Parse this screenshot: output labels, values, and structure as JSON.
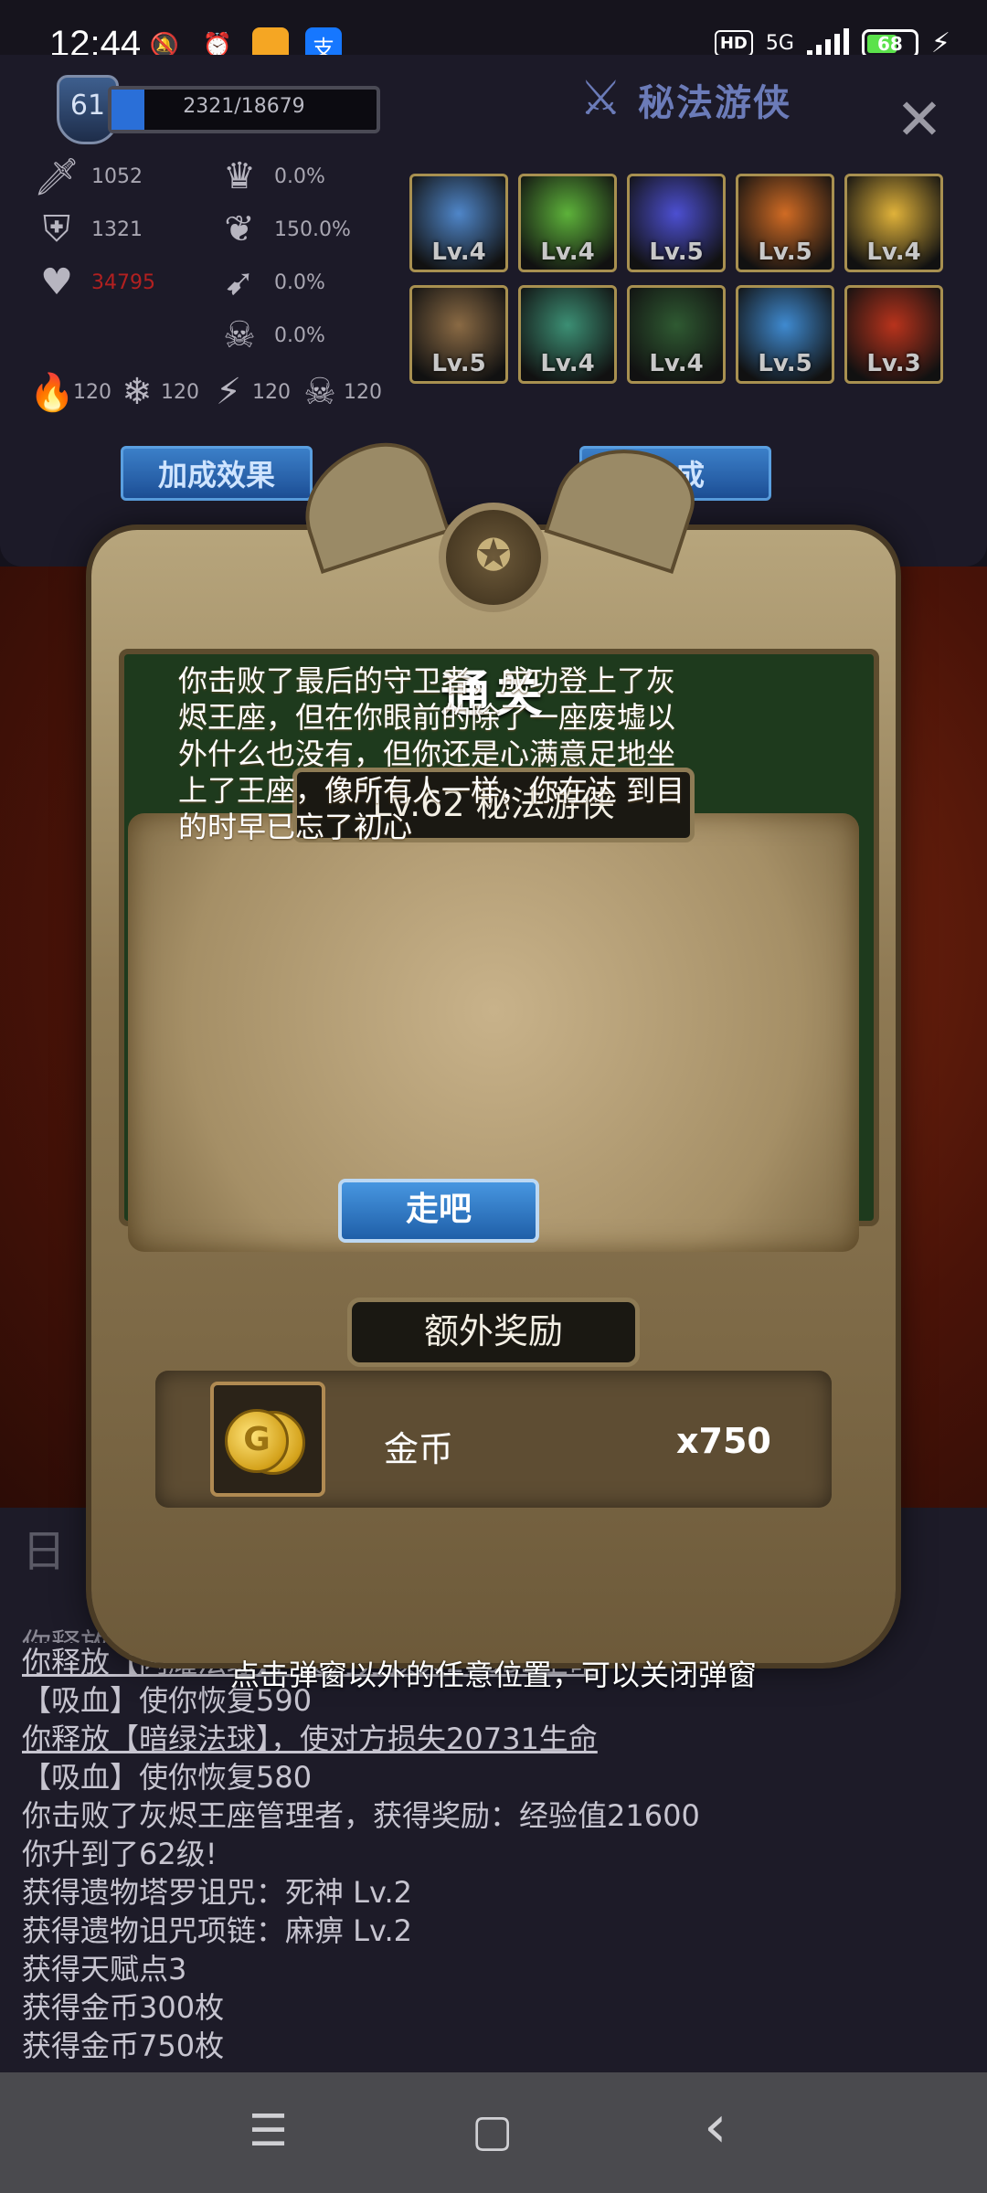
{
  "status_bar": {
    "time": "12:44",
    "icons": [
      "mute-icon",
      "alarm-icon",
      "app-icon",
      "alipay-icon"
    ],
    "hd": "HD",
    "network": "5G",
    "battery": 68
  },
  "player": {
    "level": "61",
    "xp_text": "2321/18679",
    "xp_fraction": 0.124,
    "class_name": "秘法游侠"
  },
  "stats": {
    "attack": "1052",
    "defense": "1321",
    "hp": "34795",
    "crit": "0.0%",
    "lifesteal": "150.0%",
    "pierce": "0.0%",
    "curse": "0.0%",
    "fire": "120",
    "ice": "120",
    "lightning": "120",
    "poison": "120"
  },
  "skills": [
    {
      "level": "Lv.4",
      "color": "#4f86c9"
    },
    {
      "level": "Lv.4",
      "color": "#5db23a"
    },
    {
      "level": "Lv.5",
      "color": "#4c4fd1"
    },
    {
      "level": "Lv.5",
      "color": "#d06b24"
    },
    {
      "level": "Lv.4",
      "color": "#e0b23a"
    },
    {
      "level": "Lv.5",
      "color": "#8a6a44"
    },
    {
      "level": "Lv.4",
      "color": "#3c8f74"
    },
    {
      "level": "Lv.4",
      "color": "#2f5a32"
    },
    {
      "level": "Lv.5",
      "color": "#3f8ad0"
    },
    {
      "level": "Lv.3",
      "color": "#b8331c"
    }
  ],
  "buttons": {
    "bonus_effect": "加成效果",
    "synthesis": "合成"
  },
  "log": {
    "title": "日",
    "lines": [
      {
        "text": "你释放【灵感术】的火焰【火焰弧】",
        "partial": true
      },
      {
        "text": "你释放【闪耀法球】，使对方损失21055生命",
        "u": true
      },
      {
        "text": "【吸血】使你恢复590"
      },
      {
        "text": "你释放【暗绿法球】，使对方损失20731生命",
        "u": true
      },
      {
        "text": "【吸血】使你恢复580"
      },
      {
        "text": "你击败了灰烬王座管理者，获得奖励：经验值21600"
      },
      {
        "text": "你升到了62级!"
      },
      {
        "text": "获得遗物塔罗诅咒：死神 Lv.2"
      },
      {
        "text": "获得遗物诅咒项链：麻痹 Lv.2"
      },
      {
        "text": "获得天赋点3"
      },
      {
        "text": "获得金币300枚"
      },
      {
        "text": "获得金币750枚"
      }
    ]
  },
  "modal": {
    "title": "通关",
    "subtitle": "Lv.62 秘法游侠",
    "story": "你击败了最后的守卫者，成功登上了灰烬王座，但在你眼前的除了一座废墟以外什么也没有，但你还是心满意足地坐上了王座，像所有人一样，你在达 到目的时早已忘了初心",
    "go_button": "走吧",
    "bonus_title": "额外奖励",
    "reward_name": "金币",
    "reward_count": "x750",
    "hint": "点击弹窗以外的任意位置，可以关闭弹窗"
  },
  "nav": {
    "menu": "☰",
    "home": "▢",
    "back": "‹"
  }
}
